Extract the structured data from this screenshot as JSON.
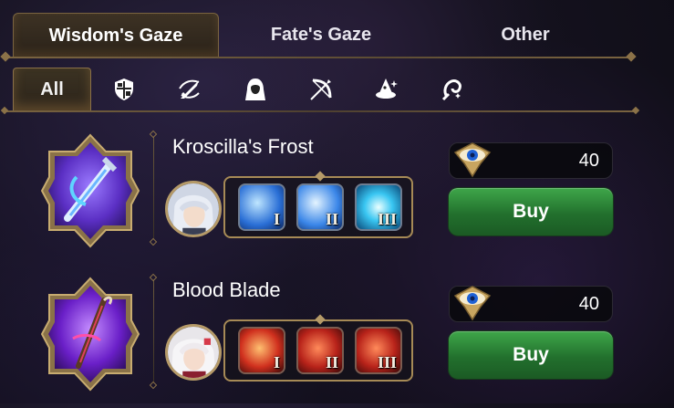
{
  "tabs": [
    {
      "label": "Wisdom's Gaze",
      "active": true
    },
    {
      "label": "Fate's Gaze",
      "active": false
    },
    {
      "label": "Other",
      "active": false
    }
  ],
  "filters": [
    {
      "label": "All",
      "icon": null,
      "active": true
    },
    {
      "label": "",
      "icon": "shield-icon"
    },
    {
      "label": "",
      "icon": "sword-icon"
    },
    {
      "label": "",
      "icon": "hooded-figure-icon"
    },
    {
      "label": "",
      "icon": "bow-icon"
    },
    {
      "label": "",
      "icon": "wizard-hat-icon"
    },
    {
      "label": "",
      "icon": "soul-icon"
    }
  ],
  "items": [
    {
      "name": "Kroscilla's Frost",
      "skills": [
        "I",
        "II",
        "III"
      ],
      "price": "40",
      "buy_label": "Buy",
      "accent": "#6a3fd6"
    },
    {
      "name": "Blood Blade",
      "skills": [
        "I",
        "II",
        "III"
      ],
      "price": "40",
      "buy_label": "Buy",
      "accent": "#7b2ad6"
    }
  ],
  "colors": {
    "gold": "#a68a56",
    "buy_green": "#2f8a3a"
  }
}
